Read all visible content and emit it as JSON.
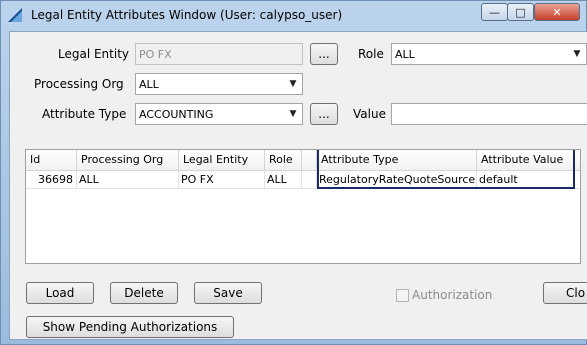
{
  "window": {
    "title": "Legal Entity Attributes Window (User: calypso_user)",
    "min_glyph": "—",
    "max_glyph": "□",
    "close_glyph": "✕"
  },
  "form": {
    "legal_entity_label": "Legal Entity",
    "legal_entity_value": "PO FX",
    "browse_label": "...",
    "role_label": "Role",
    "role_value": "ALL",
    "processing_org_label": "Processing Org",
    "processing_org_value": "ALL",
    "attribute_type_label": "Attribute Type",
    "attribute_type_value": "ACCOUNTING",
    "value_label": "Value",
    "value_value": ""
  },
  "table": {
    "columns": [
      "Id",
      "Processing Org",
      "Legal Entity",
      "Role",
      "Attribute Type",
      "Attribute Value"
    ],
    "rows": [
      [
        "36698",
        "ALL",
        "PO FX",
        "ALL",
        "RegulatoryRateQuoteSource",
        "default"
      ]
    ]
  },
  "buttons": {
    "load": "Load",
    "delete": "Delete",
    "save": "Save",
    "authorization_label": "Authorization",
    "close": "Clo",
    "show_pending": "Show Pending Authorizations"
  },
  "colors": {
    "highlight_border": "#1a2a66",
    "window_frame": "#9bbcdf",
    "close_button": "#c7402a"
  }
}
